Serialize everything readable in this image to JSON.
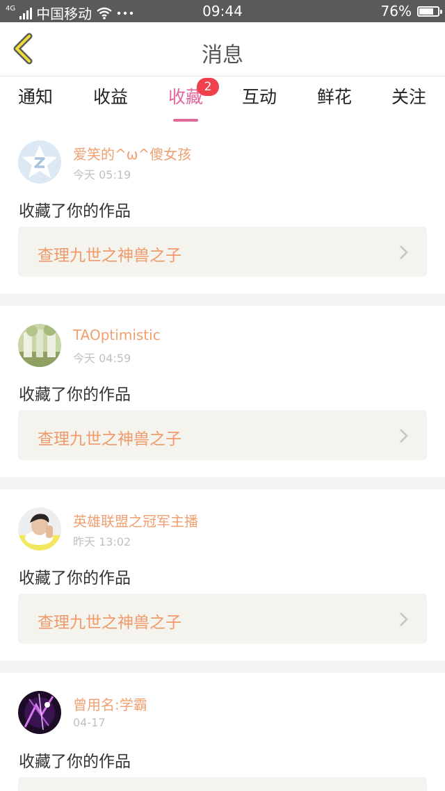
{
  "status_bar": {
    "network": "4G",
    "carrier": "中国移动",
    "time": "09:44",
    "battery_text": "76%",
    "battery_level": 0.76
  },
  "header": {
    "title": "消息",
    "back_icon": "chevron-left-icon"
  },
  "tabs": [
    {
      "label": "通知"
    },
    {
      "label": "收益"
    },
    {
      "label": "收藏",
      "badge": "2",
      "active": true
    },
    {
      "label": "互动"
    },
    {
      "label": "鲜花"
    },
    {
      "label": "关注"
    }
  ],
  "messages": [
    {
      "username": "爱笑的^ω^傻女孩",
      "time": "今天 05:19",
      "action": "收藏了你的作品",
      "work_title": "查理九世之神兽之子"
    },
    {
      "username": "TAOptimistic",
      "time": "今天 04:59",
      "action": "收藏了你的作品",
      "work_title": "查理九世之神兽之子"
    },
    {
      "username": "英雄联盟之冠军主播",
      "time": "昨天 13:02",
      "action": "收藏了你的作品",
      "work_title": "查理九世之神兽之子"
    },
    {
      "username": "曾用名:学霸",
      "time": "04-17",
      "action": "收藏了你的作品",
      "work_title": ""
    }
  ],
  "colors": {
    "accent": "#e2679a",
    "badge": "#f0404b",
    "username": "#f0a070",
    "work_title": "#ef9a6a"
  }
}
